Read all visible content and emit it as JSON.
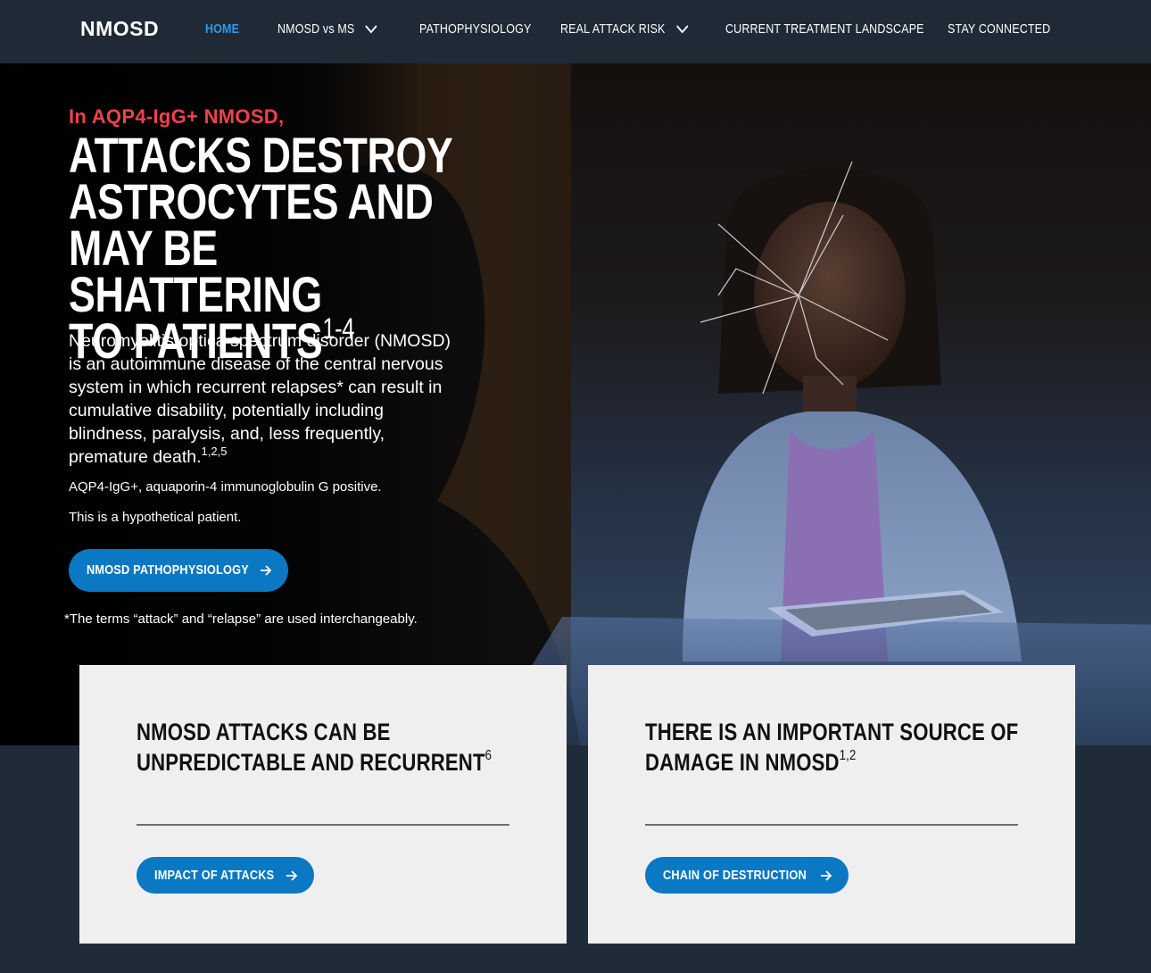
{
  "nav": {
    "logo": "NMOSD",
    "items": [
      {
        "label": "HOME",
        "active": true,
        "dropdown": false
      },
      {
        "label": "NMOSD vs MS",
        "active": false,
        "dropdown": true
      },
      {
        "label": "PATHOPHYSIOLOGY",
        "active": false,
        "dropdown": false
      },
      {
        "label": "REAL ATTACK RISK",
        "active": false,
        "dropdown": true
      },
      {
        "label": "CURRENT TREATMENT LANDSCAPE",
        "active": false,
        "dropdown": false
      },
      {
        "label": "STAY CONNECTED",
        "active": false,
        "dropdown": false
      }
    ]
  },
  "hero": {
    "eyebrow": "In AQP4-IgG+ NMOSD,",
    "headline_lines": [
      "ATTACKS DESTROY",
      "ASTROCYTES AND",
      "MAY BE SHATTERING",
      "TO PATIENTS"
    ],
    "headline_ref": "1-4",
    "body": "Neuromyelitis optica spectrum disorder (NMOSD) is an autoimmune disease of the central nervous system in which recurrent relapses* can result in cumulative disability, potentially including blindness, paralysis, and, less frequently, premature death.",
    "body_ref": "1,2,5",
    "abbreviation": "AQP4-IgG+, aquaporin-4 immunoglobulin G positive.",
    "hypothetical": "This is a hypothetical patient.",
    "cta_label": "NMOSD PATHOPHYSIOLOGY",
    "footnote": "*The terms “attack” and “relapse” are used interchangeably."
  },
  "cards": [
    {
      "title_line1": "NMOSD ATTACKS CAN BE",
      "title_line2": "UNPREDICTABLE AND RECURRENT",
      "ref": "6",
      "button": "IMPACT OF ATTACKS"
    },
    {
      "title_line1": "THERE IS AN IMPORTANT SOURCE OF",
      "title_line2": "DAMAGE IN NMOSD",
      "ref": "1,2",
      "button": "CHAIN OF DESTRUCTION"
    }
  ],
  "colors": {
    "nav_bg": "#1f2a36",
    "accent_blue": "#0a78c2",
    "active_nav": "#2a9be8",
    "eyebrow_red": "#f0414f",
    "card_bg": "#efefef"
  }
}
